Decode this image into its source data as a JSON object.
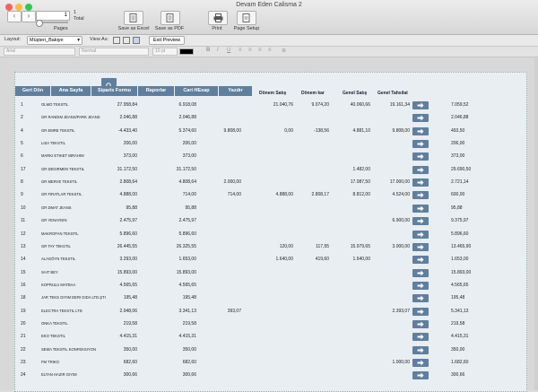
{
  "window": {
    "title": "Devam Eden Calisma 2"
  },
  "toolbar": {
    "page_number": "1",
    "page_total": "1",
    "total_label": "Total",
    "pages_label": "Pages",
    "save_excel": "Save as Excel",
    "save_pdf": "Save as PDF",
    "print": "Print",
    "page_setup": "Page Setup"
  },
  "layoutbar": {
    "layout_label": "Layout:",
    "layout_value": "Müşteri_Bakiye",
    "view_as_label": "View As:",
    "exit_preview": "Exit Preview"
  },
  "formatbar": {
    "font": "Arial",
    "style": "Normal",
    "size": "10 pt"
  },
  "table": {
    "headers": [
      "Geri Dön",
      "Ana Sayfa",
      "Siparis Formu",
      "Raporlar",
      "Cari HEsap",
      "Yazdır"
    ],
    "extra_headers": [
      "Dönem Satış",
      "Dönem kar",
      "Genel Satış",
      "Genel Tahsilat"
    ],
    "rows": [
      {
        "no": "1",
        "name": "OLMO TEKSTIL",
        "a": "27.958,84",
        "b": "6.918,08",
        "c": "",
        "d": "21.040,76",
        "e": "9.074,20",
        "f": "40.060,66",
        "g": "19.161,34",
        "h": "7.059,52"
      },
      {
        "no": "2",
        "name": "GR RANDIM JEANS/PARK JEANS",
        "a": "2.046,88",
        "b": "2.046,88",
        "c": "",
        "d": "",
        "e": "",
        "f": "",
        "g": "",
        "h": "2.046,88"
      },
      {
        "no": "4",
        "name": "GR EMRE TEKSTIL",
        "a": "-4.433,40",
        "b": "5.374,60",
        "c": "9.808,00",
        "d": "0,00",
        "e": "-138,56",
        "f": "4.881,10",
        "g": "9.808,00",
        "h": "493,50"
      },
      {
        "no": "5",
        "name": "LISA TEKSTIL",
        "a": "206,00",
        "b": "206,00",
        "c": "",
        "d": "",
        "e": "",
        "f": "",
        "g": "",
        "h": "206,00"
      },
      {
        "no": "6",
        "name": "MARKI ETIKET IBRAHIM",
        "a": "373,00",
        "b": "373,00",
        "c": "",
        "d": "",
        "e": "",
        "f": "",
        "g": "",
        "h": "373,00"
      },
      {
        "no": "17",
        "name": "GR DEGIRMEN TEKSTIL",
        "a": "31.172,50",
        "b": "31.172,50",
        "c": "",
        "d": "",
        "e": "",
        "f": "1.482,00",
        "g": "",
        "h": "29.690,50"
      },
      {
        "no": "8",
        "name": "GR MERVE TEKSTIL",
        "a": "2.808,64",
        "b": "4.808,64",
        "c": "2.000,00",
        "d": "",
        "e": "",
        "f": "17.087,50",
        "g": "17.000,00",
        "h": "2.721,14"
      },
      {
        "no": "9",
        "name": "GR FIRATLAR TEKSTIL",
        "a": "4.888,00",
        "b": "714,00",
        "c": "714,00",
        "d": "4.888,00",
        "e": "2.808,17",
        "f": "8.812,00",
        "g": "4.524,00",
        "h": "600,00"
      },
      {
        "no": "10",
        "name": "GR DMAT JEANS",
        "a": "95,88",
        "b": "95,88",
        "c": "",
        "d": "",
        "e": "",
        "f": "",
        "g": "",
        "h": "95,88"
      },
      {
        "no": "11",
        "name": "GR YENAYDIN",
        "a": "2.475,97",
        "b": "2.475,97",
        "c": "",
        "d": "",
        "e": "",
        "f": "",
        "g": "6.900,00",
        "h": "9.375,97"
      },
      {
        "no": "12",
        "name": "MAKROFAN TEKSTIL",
        "a": "5.896,60",
        "b": "5.896,60",
        "c": "",
        "d": "",
        "e": "",
        "f": "",
        "g": "",
        "h": "5.896,60"
      },
      {
        "no": "13",
        "name": "GR TAY TEKSTIL",
        "a": "26.445,55",
        "b": "26.325,55",
        "c": "",
        "d": "120,00",
        "e": "117,55",
        "f": "15.979,65",
        "g": "3.000,00",
        "h": "13.465,90"
      },
      {
        "no": "14",
        "name": "ALAGÖYN TEKSTIL",
        "a": "3.293,00",
        "b": "1.653,00",
        "c": "",
        "d": "1.640,00",
        "e": "419,60",
        "f": "1.640,00",
        "g": "",
        "h": "1.653,00"
      },
      {
        "no": "15",
        "name": "SAIT BEY",
        "a": "15.893,00",
        "b": "15.893,00",
        "c": "",
        "d": "",
        "e": "",
        "f": "",
        "g": "",
        "h": "15.893,00"
      },
      {
        "no": "16",
        "name": "KOPRULU MATBAA",
        "a": "4.565,65",
        "b": "4.565,65",
        "c": "",
        "d": "",
        "e": "",
        "f": "",
        "g": "",
        "h": "4.565,65"
      },
      {
        "no": "18",
        "name": "JAR TEKS GIYIM DERI GIDA LTD.ŞTI",
        "a": "195,48",
        "b": "195,48",
        "c": "",
        "d": "",
        "e": "",
        "f": "",
        "g": "",
        "h": "195,48"
      },
      {
        "no": "19",
        "name": "ELECTRA TEKSTIL LTD",
        "a": "2.948,06",
        "b": "3.341,13",
        "c": "393,07",
        "d": "",
        "e": "",
        "f": "",
        "g": "2.393,07",
        "h": "5.341,13"
      },
      {
        "no": "20",
        "name": "ONKA TEKSTIL",
        "a": "219,58",
        "b": "219,58",
        "c": "",
        "d": "",
        "e": "",
        "f": "",
        "g": "",
        "h": "219,58"
      },
      {
        "no": "21",
        "name": "EKO TEKSTIL",
        "a": "4.415,31",
        "b": "4.415,31",
        "c": "",
        "d": "",
        "e": "",
        "f": "",
        "g": "",
        "h": "4.415,31"
      },
      {
        "no": "22",
        "name": "SEMA TEKSTIL KONFEKSIYON",
        "a": "350,00",
        "b": "350,00",
        "c": "",
        "d": "",
        "e": "",
        "f": "",
        "g": "",
        "h": "350,00"
      },
      {
        "no": "23",
        "name": "FM TRIKO",
        "a": "682,60",
        "b": "682,60",
        "c": "",
        "d": "",
        "e": "",
        "f": "",
        "g": "1.000,00",
        "h": "1.682,60"
      },
      {
        "no": "24",
        "name": "ELTAN HAZIR GIYIM",
        "a": "300,66",
        "b": "300,66",
        "c": "",
        "d": "",
        "e": "",
        "f": "",
        "g": "",
        "h": "300,66"
      }
    ]
  }
}
